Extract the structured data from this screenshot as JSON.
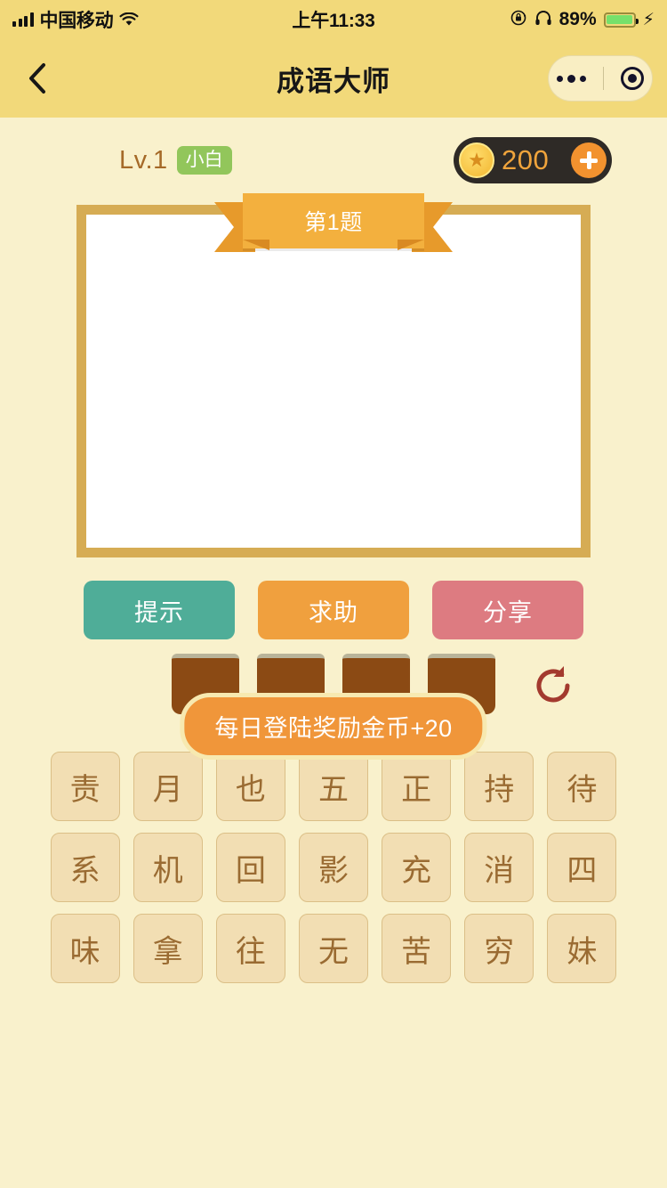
{
  "statusbar": {
    "carrier": "中国移动",
    "time": "上午11:33",
    "battery_pct": "89%",
    "signal_icon": "signal-bars-icon",
    "wifi_icon": "wifi-icon",
    "rotation_lock_icon": "rotation-lock-icon",
    "headphones_icon": "headphones-icon",
    "battery_icon": "battery-icon",
    "charging_icon": "lightning-bolt-icon"
  },
  "navbar": {
    "title": "成语大师",
    "back_icon": "back-chevron-icon",
    "menu_icon": "more-dots-icon",
    "target_icon": "circle-target-icon"
  },
  "info": {
    "level": "Lv.1",
    "rank_badge": "小白",
    "coins": "200",
    "coin_icon": "star-coin-icon",
    "add_coin_icon": "plus-icon"
  },
  "board": {
    "question_label": "第1题",
    "image_placeholder": ""
  },
  "actions": [
    {
      "label": "提示",
      "name": "hint-button",
      "color": "#4FAD98"
    },
    {
      "label": "求助",
      "name": "help-button",
      "color": "#F0A03E"
    },
    {
      "label": "分享",
      "name": "share-button",
      "color": "#DD7B81"
    }
  ],
  "answer_slots": [
    "",
    "",
    "",
    ""
  ],
  "refresh": {
    "icon": "refresh-icon"
  },
  "toast": {
    "message": "每日登陆奖励金币+20"
  },
  "tiles": {
    "rows": [
      [
        "责",
        "月",
        "也",
        "五",
        "正",
        "持",
        "待"
      ],
      [
        "系",
        "机",
        "回",
        "影",
        "充",
        "消",
        "四"
      ],
      [
        "味",
        "拿",
        "往",
        "无",
        "苦",
        "穷",
        "妹"
      ]
    ],
    "flat": [
      "责",
      "月",
      "也",
      "五",
      "正",
      "持",
      "待",
      "系",
      "机",
      "回",
      "影",
      "充",
      "消",
      "四",
      "味",
      "拿",
      "往",
      "无",
      "苦",
      "穷",
      "妹"
    ]
  },
  "colors": {
    "header": "#F2D97A",
    "background": "#F9F1CC",
    "board_border": "#D6AC54",
    "ribbon": "#F3B03E",
    "coin_pill": "#2E2A26",
    "tile_bg": "#F2DEB3",
    "tile_text": "#9A6B32",
    "slot": "#8B4A14",
    "refresh": "#A33A2E",
    "badge_green": "#92C65B"
  }
}
